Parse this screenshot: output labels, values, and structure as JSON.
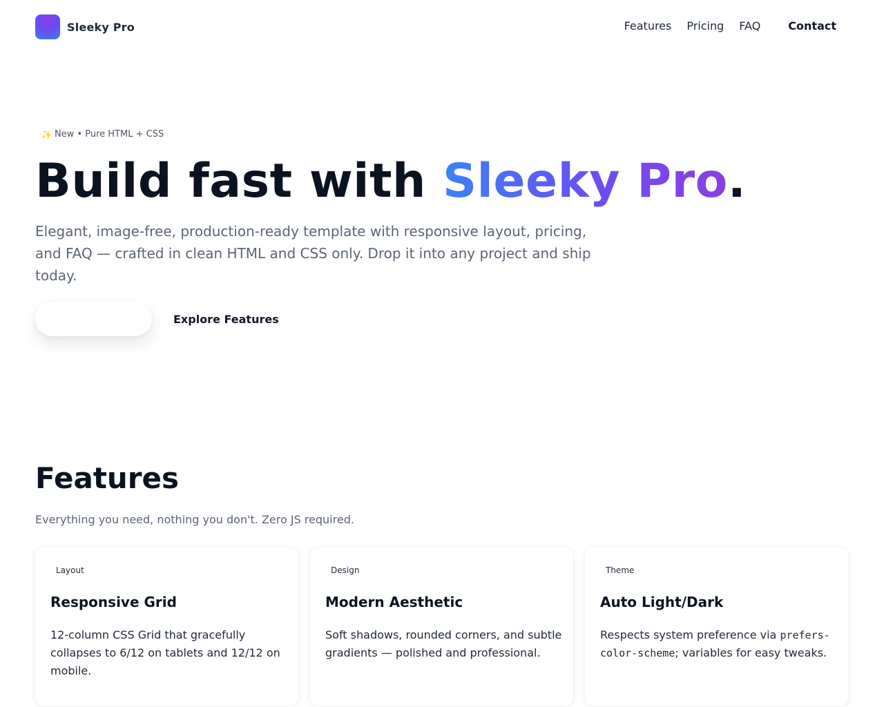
{
  "header": {
    "brand_name": "Sleeky Pro",
    "nav": [
      "Features",
      "Pricing",
      "FAQ"
    ],
    "contact_label": "Contact"
  },
  "hero": {
    "eyebrow_icon": "sparkles-icon",
    "eyebrow": "New • Pure HTML + CSS",
    "title_prefix": "Build fast with ",
    "title_highlight": "Sleeky Pro",
    "title_suffix": ".",
    "subtitle": "Elegant, image-free, production-ready template with responsive layout, pricing, and FAQ — crafted in clean HTML and CSS only. Drop it into any project and ship today.",
    "primary_button_label": "",
    "secondary_button_label": "Explore Features"
  },
  "features": {
    "title": "Features",
    "subtitle": "Everything you need, nothing you don't. Zero JS required.",
    "cards": [
      {
        "tag": "Layout",
        "title": "Responsive Grid",
        "body": "12-column CSS Grid that gracefully collapses to 6/12 on tablets and 12/12 on mobile."
      },
      {
        "tag": "Design",
        "title": "Modern Aesthetic",
        "body": "Soft shadows, rounded corners, and subtle gradients — polished and professional."
      },
      {
        "tag": "Theme",
        "title": "Auto Light/Dark",
        "body_before": "Respects system preference via ",
        "body_code": "prefers-color-scheme",
        "body_after": "; variables for easy tweaks."
      }
    ]
  },
  "colors": {
    "gradient_start": "#3b82f6",
    "gradient_end": "#8b3fe0",
    "text_primary": "#0b1220",
    "text_muted": "#5b6576"
  }
}
